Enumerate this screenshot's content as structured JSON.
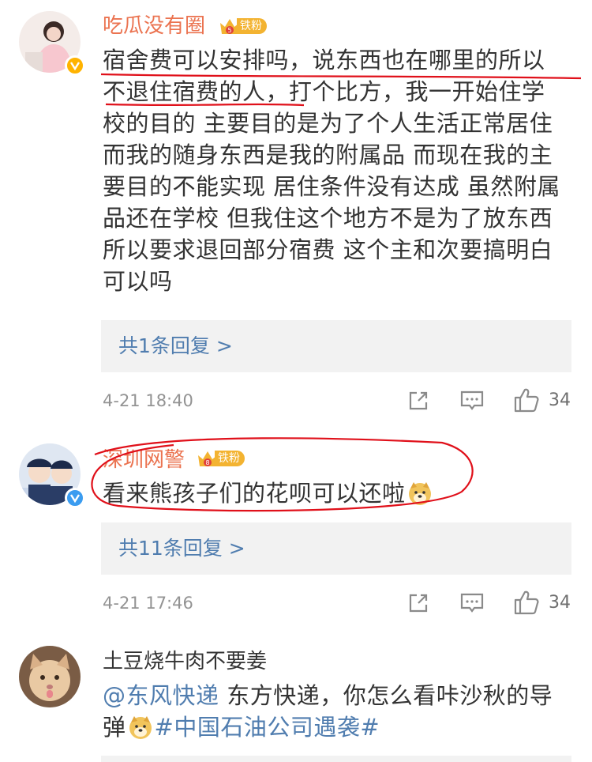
{
  "comments": [
    {
      "username": "吃瓜没有圈",
      "fan_badge": "铁粉",
      "text_lines": [
        "宿舍费可以安排吗，说东西也在哪里的所以",
        "不退住宿费的人，打个比方，我一开始住学",
        "校的目的 主要目的是为了个人生活正常居住",
        "而我的随身东西是我的附属品 而现在我的主",
        "要目的不能实现 居住条件没有达成 虽然附属",
        "品还在学校 但我住这个地方不是为了放东西",
        "所以要求退回部分宿费 这个主和次要搞明白",
        "可以吗"
      ],
      "reply_label": "共1条回复 >",
      "timestamp": "4-21 18:40",
      "likes": "34"
    },
    {
      "username": "深圳网警",
      "fan_badge": "铁粉",
      "text": "看来熊孩子们的花呗可以还啦",
      "reply_label": "共11条回复 >",
      "timestamp": "4-21 17:46",
      "likes": "34"
    },
    {
      "username": "土豆烧牛肉不要姜",
      "mention": "@东风快递",
      "text_line1_rest": " 东方快递，你怎么看咔沙秋的导",
      "text_line2_start": "弹",
      "hashtag": "#中国石油公司遇袭#"
    }
  ],
  "colors": {
    "username_accent": "#eb7350",
    "link": "#507daf",
    "annotation_red": "#e0101a",
    "verified_badge": "#ffb300"
  },
  "icons": [
    "share-icon",
    "comment-icon",
    "like-icon",
    "doge-emoji",
    "crown-icon",
    "verified-icon"
  ]
}
